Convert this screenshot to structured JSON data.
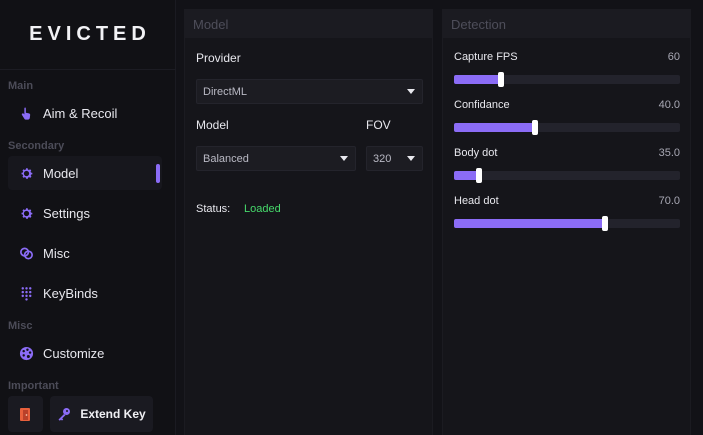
{
  "brand": "EVICTED",
  "sidebar": {
    "sections": {
      "main": "Main",
      "secondary": "Secondary",
      "misc": "Misc",
      "important": "Important"
    },
    "items": [
      {
        "label": "Aim & Recoil",
        "icon": "hand-pointer-icon"
      },
      {
        "label": "Model",
        "icon": "gear-icon",
        "active": true
      },
      {
        "label": "Settings",
        "icon": "gear-icon"
      },
      {
        "label": "Misc",
        "icon": "link-icon"
      },
      {
        "label": "KeyBinds",
        "icon": "keypad-icon"
      },
      {
        "label": "Customize",
        "icon": "palette-icon"
      }
    ],
    "exit_icon": "door-exit-icon",
    "extend_key": {
      "label": "Extend Key",
      "icon": "key-icon"
    }
  },
  "model_panel": {
    "title": "Model",
    "provider_label": "Provider",
    "provider_value": "DirectML",
    "model_label": "Model",
    "model_value": "Balanced",
    "fov_label": "FOV",
    "fov_value": "320",
    "status_label": "Status:",
    "status_value": "Loaded"
  },
  "detection_panel": {
    "title": "Detection",
    "sliders": [
      {
        "label": "Capture FPS",
        "value_text": "60",
        "fraction": 0.21
      },
      {
        "label": "Confidance",
        "value_text": "40.0",
        "fraction": 0.36
      },
      {
        "label": "Body dot",
        "value_text": "35.0",
        "fraction": 0.11
      },
      {
        "label": "Head dot",
        "value_text": "70.0",
        "fraction": 0.67
      }
    ]
  },
  "colors": {
    "accent": "#8b6cf6",
    "status_ok": "#46d96b",
    "exit_icon": "#e8603c",
    "background": "#121217"
  }
}
